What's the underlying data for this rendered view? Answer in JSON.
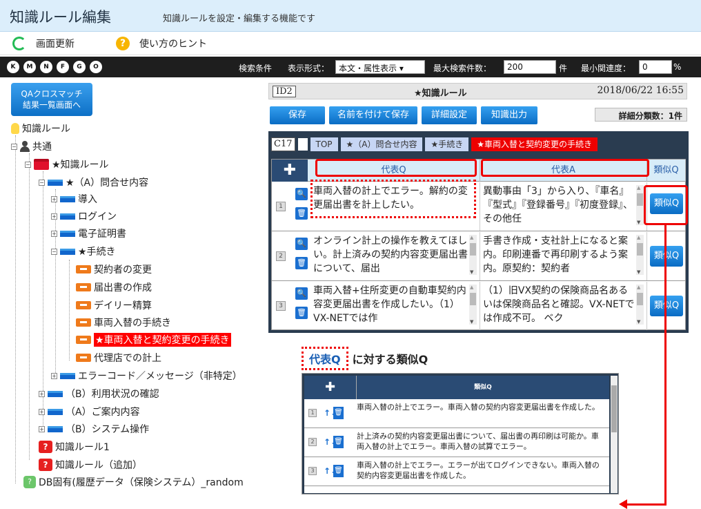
{
  "header": {
    "title": "知識ルール編集",
    "subtitle": "知識ルールを設定・編集する機能です"
  },
  "toolbar": {
    "refresh": "画面更新",
    "hint": "使い方のヒント"
  },
  "nav_buttons": [
    "K",
    "M",
    "N",
    "F",
    "G",
    "O"
  ],
  "search": {
    "label": "検索条件",
    "format_label": "表示形式：",
    "format_value": "本文・属性表示 ▾",
    "max_label": "最大検索件数：",
    "max_value": "200",
    "max_unit": "件",
    "min_label": "最小関連度：",
    "min_value": "0",
    "min_unit": "%"
  },
  "qa_button": "QAクロスマッチ\n結果一覧画面へ",
  "tree": {
    "root": "知識ルール",
    "common": "共通",
    "rule": "★知識ルール",
    "inq": "★（A）問合せ内容",
    "intro": "導入",
    "login": "ログイン",
    "cert": "電子証明書",
    "proc": "★手続き",
    "p1": "契約者の変更",
    "p2": "届出書の作成",
    "p3": "デイリー精算",
    "p4": "車両入替の手続き",
    "p5": "★車両入替と契約変更の手続き",
    "p6": "代理店での計上",
    "err": "エラーコード／メッセージ（非特定）",
    "usage": "（B）利用状況の確認",
    "guide": "（A）ご案内内容",
    "sys": "（B）システム操作",
    "k1": "知識ルール1",
    "k2": "知識ルール（追加）",
    "db": "DB固有(履歴データ（保険システム）_random"
  },
  "rule_header": {
    "id": "ID2",
    "title": "★知識ルール",
    "datetime": "2018/06/22 16:55"
  },
  "actions": {
    "save": "保存",
    "save_as": "名前を付けて保存",
    "detail": "詳細設定",
    "export": "知識出力",
    "count": "詳細分類数：1件"
  },
  "breadcrumb": {
    "id": "C17",
    "items": [
      "TOP",
      "★（A）問合せ内容",
      "★手続き",
      "★車両入替と契約変更の手続き"
    ]
  },
  "table": {
    "headers": {
      "q": "代表Q",
      "a": "代表A",
      "sim": "類似Q"
    },
    "sim_button": "類似Q",
    "rows": [
      {
        "n": "1",
        "q": "車両入替の計上でエラー。解約の変更届出書を計上したい。",
        "a": "異動事由「3」から入り、『車名』『型式』『登録番号』『初度登録』、その他任"
      },
      {
        "n": "2",
        "q": "オンライン計上の操作を教えてほしい。計上済みの契約内容変更届出書について、届出",
        "a": "手書き作成・支社計上になると案内。印刷連番で再印刷するよう案内。原契約：契約者"
      },
      {
        "n": "3",
        "q": "車両入替+住所変更の自動車契約内容変更届出書を作成したい。（1）VX-NETでは作",
        "a": "（1）旧VX契約の保険商品名あるいは保険商品名と確認。VX-NETでは作成不可。 ベク"
      }
    ]
  },
  "section": {
    "tag": "代表Q",
    "text": "に対する類似Q"
  },
  "mini": {
    "header": "類似Q",
    "rows": [
      {
        "n": "1",
        "text": "車両入替の計上でエラー。車両入替の契約内容変更届出書を作成した。"
      },
      {
        "n": "2",
        "text": "計上済みの契約内容変更届出書について、届出書の再印刷は可能か。車両入替の計上でエラー。車両入替の試算でエラー。"
      },
      {
        "n": "3",
        "text": "車両入替の計上でエラー。エラーが出てログインできない。車両入替の契約内容変更届出書を作成した。"
      }
    ]
  }
}
